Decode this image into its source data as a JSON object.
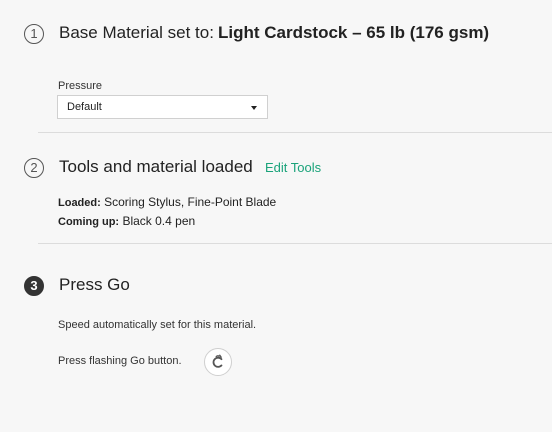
{
  "step1": {
    "number": "1",
    "title_prefix": "Base Material set to:",
    "title_value": "Light Cardstock – 65 lb (176 gsm)",
    "pressure_label": "Pressure",
    "pressure_value": "Default"
  },
  "step2": {
    "number": "2",
    "title": "Tools and material loaded",
    "edit_link": "Edit Tools",
    "loaded_key": "Loaded:",
    "loaded_value": "Scoring Stylus, Fine-Point Blade",
    "coming_key": "Coming up:",
    "coming_value": "Black 0.4 pen"
  },
  "step3": {
    "number": "3",
    "title": "Press Go",
    "speed_text": "Speed automatically set for this material.",
    "press_text": "Press flashing Go button.",
    "go_icon": "cricut-go-icon"
  }
}
